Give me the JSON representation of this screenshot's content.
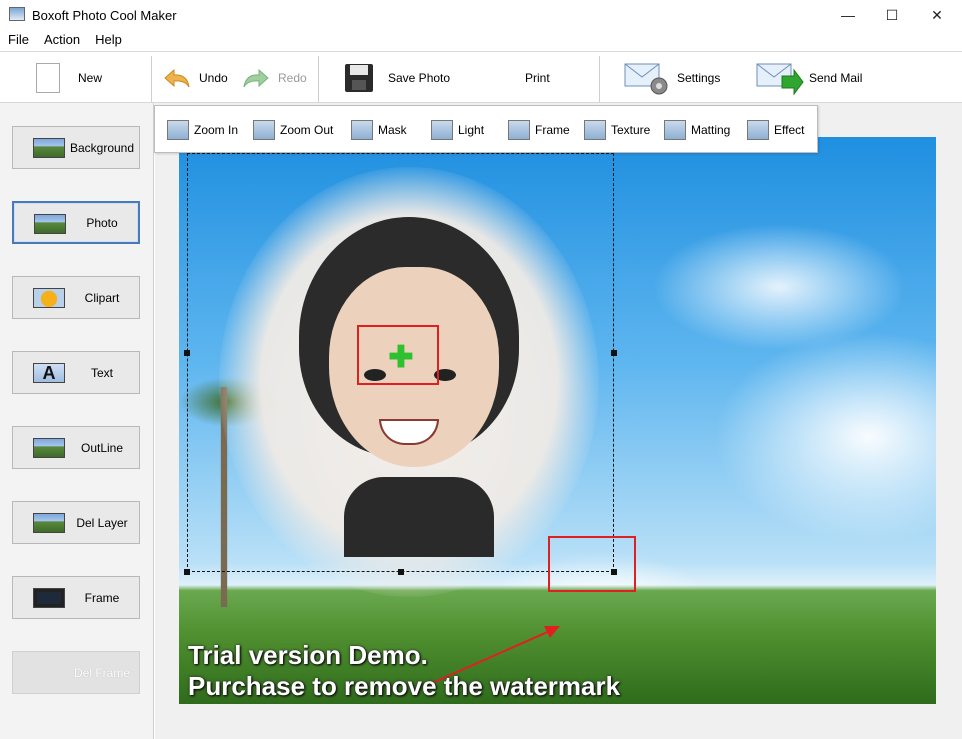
{
  "window": {
    "title": "Boxoft Photo Cool Maker"
  },
  "menu": [
    "File",
    "Action",
    "Help"
  ],
  "toolbar": {
    "new": "New",
    "undo": "Undo",
    "redo": "Redo",
    "save_photo": "Save Photo",
    "print": "Print",
    "settings": "Settings",
    "send_mail": "Send Mail"
  },
  "sidebar": {
    "items": [
      {
        "label": "Background"
      },
      {
        "label": "Photo",
        "selected": true
      },
      {
        "label": "Clipart"
      },
      {
        "label": "Text"
      },
      {
        "label": "OutLine"
      },
      {
        "label": "Del Layer"
      },
      {
        "label": "Frame"
      },
      {
        "label": "Del Frame",
        "disabled": true
      }
    ]
  },
  "subtoolbar": {
    "items": [
      "Zoom In",
      "Zoom Out",
      "Mask",
      "Light",
      "Frame",
      "Texture",
      "Matting",
      "Effect"
    ]
  },
  "canvas": {
    "watermark_line1": "Trial version Demo.",
    "watermark_line2": "Purchase to remove the watermark"
  },
  "colors": {
    "accent": "#4a78b8",
    "highlight": "#e02020",
    "move_cursor": "#2ec02e"
  }
}
